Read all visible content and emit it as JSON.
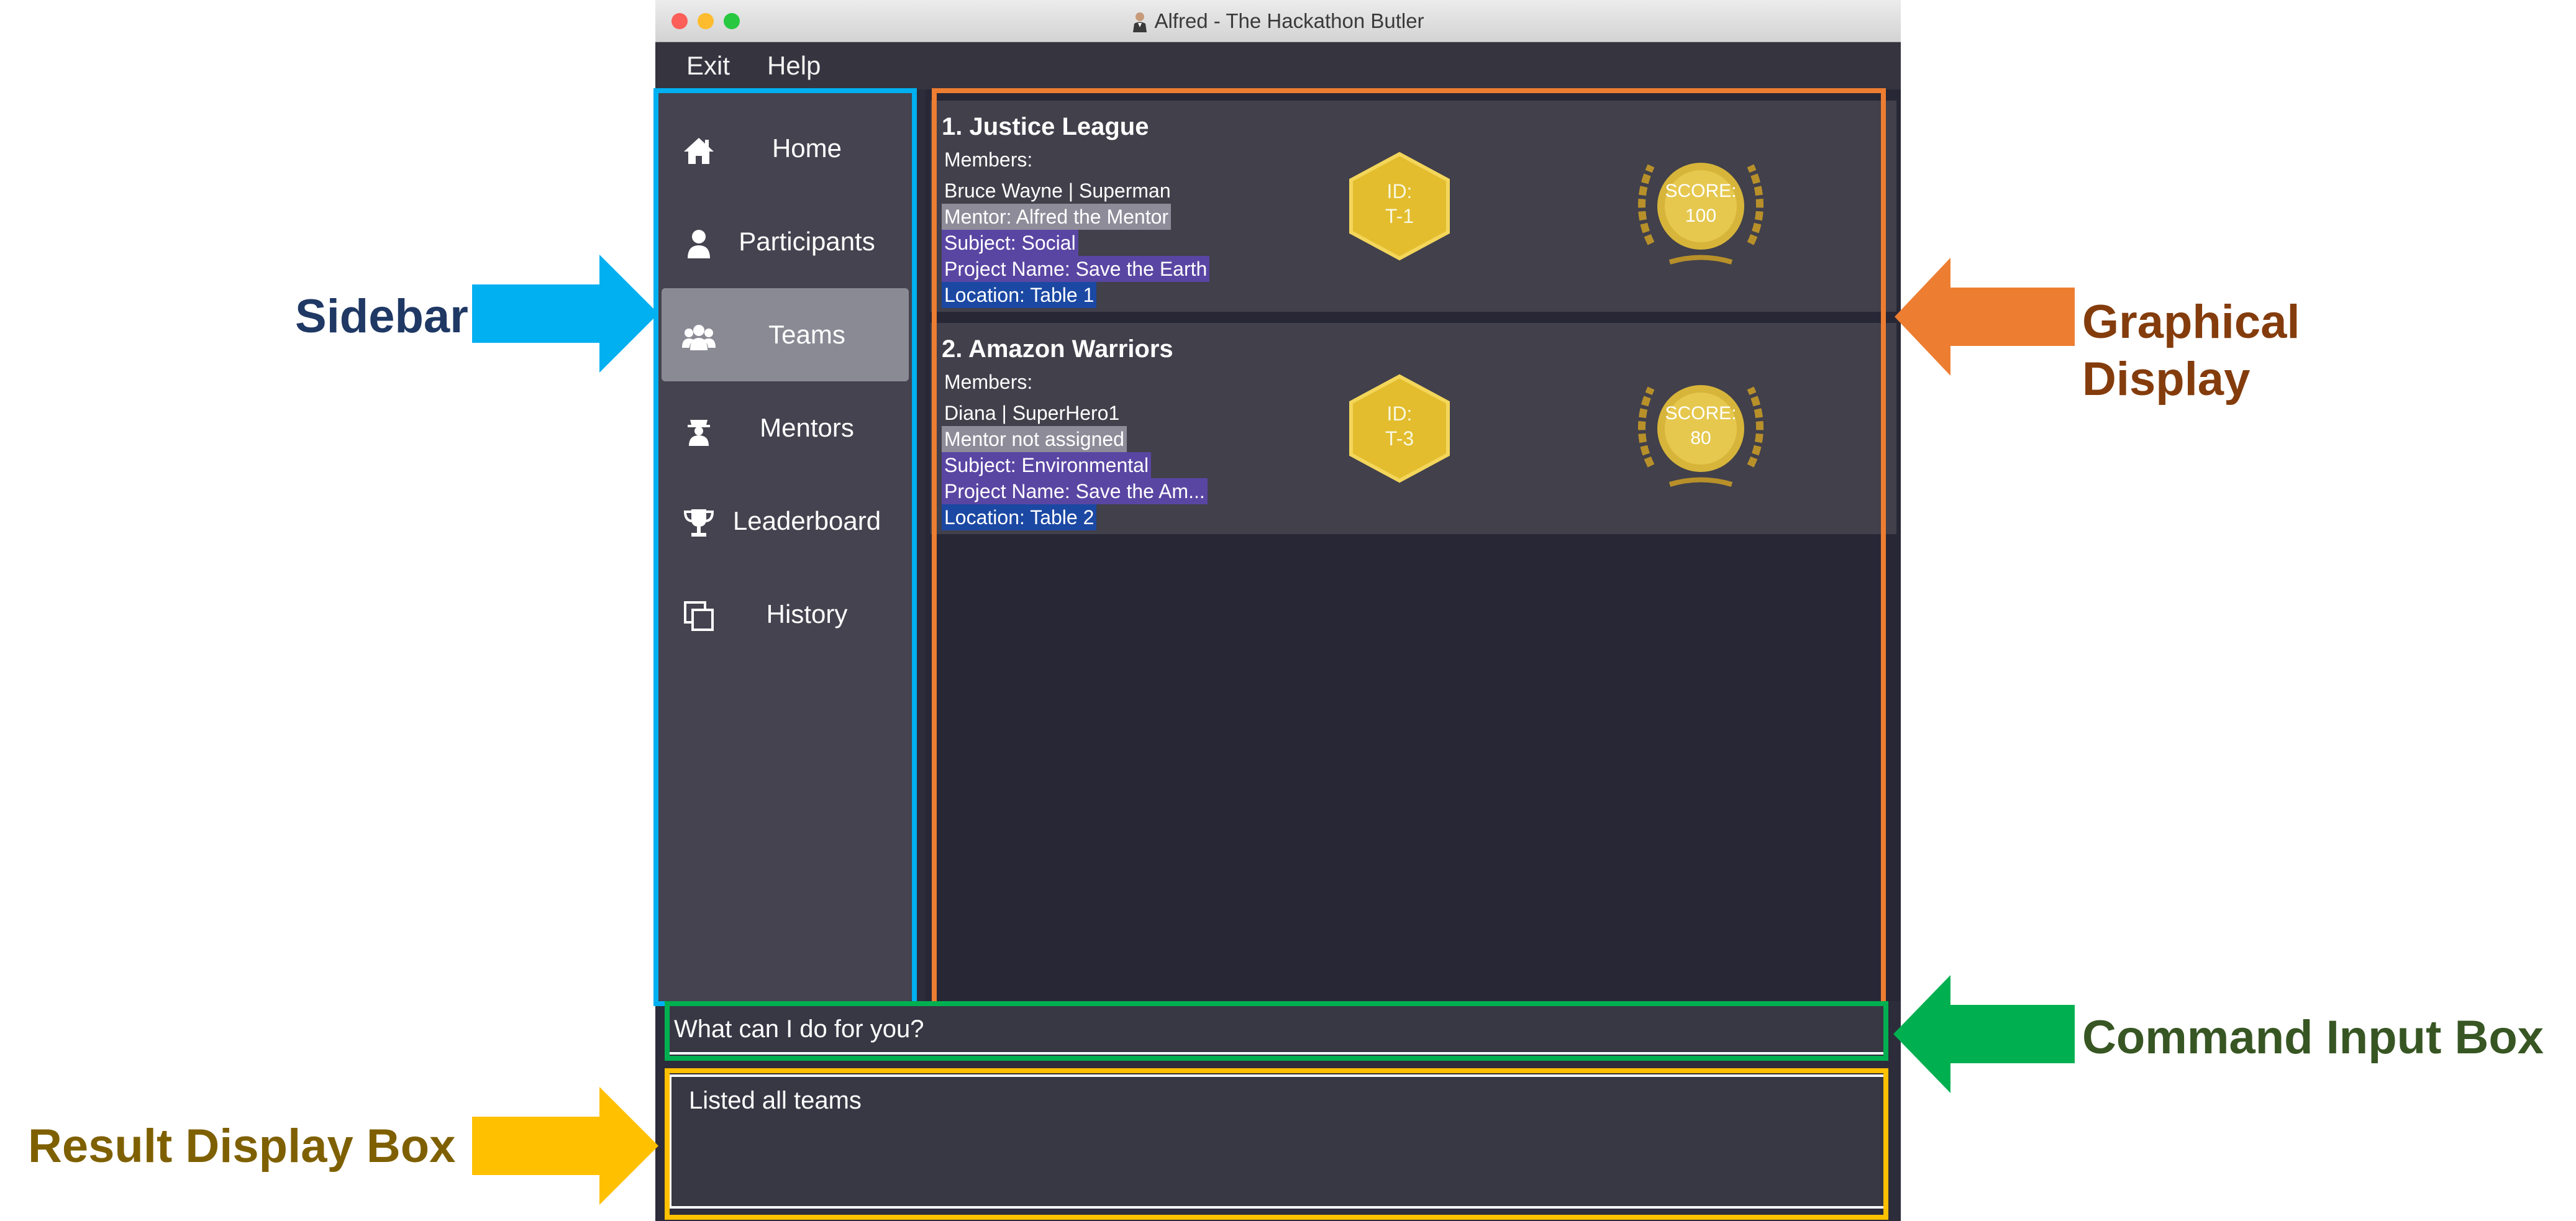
{
  "window": {
    "title": "Alfred - The Hackathon Butler",
    "menu": [
      "Exit",
      "Help"
    ]
  },
  "sidebar": {
    "items": [
      {
        "label": "Home",
        "icon": "home-icon"
      },
      {
        "label": "Participants",
        "icon": "person-icon"
      },
      {
        "label": "Teams",
        "icon": "group-icon",
        "active": true
      },
      {
        "label": "Mentors",
        "icon": "mentor-icon"
      },
      {
        "label": "Leaderboard",
        "icon": "trophy-icon"
      },
      {
        "label": "History",
        "icon": "history-icon"
      }
    ]
  },
  "teams": [
    {
      "heading": "1.  Justice League",
      "members_label": "Members:",
      "members": "Bruce Wayne | Superman",
      "mentor": "Mentor: Alfred the Mentor",
      "subject": "Subject: Social",
      "project": "Project Name: Save the Earth",
      "location": "Location:  Table 1",
      "id_label": "ID:",
      "id": "T-1",
      "score_label": "SCORE:",
      "score": "100"
    },
    {
      "heading": "2.  Amazon Warriors",
      "members_label": "Members:",
      "members": "Diana | SuperHero1",
      "mentor": "Mentor not assigned",
      "subject": "Subject: Environmental",
      "project": "Project Name: Save the Am...",
      "location": "Location:  Table 2",
      "id_label": "ID:",
      "id": "T-3",
      "score_label": "SCORE:",
      "score": "80"
    }
  ],
  "command": {
    "placeholder": "What can I do for you?"
  },
  "result": {
    "text": "Listed all teams"
  },
  "annotations": {
    "sidebar": "Sidebar",
    "graphical_display_line1": "Graphical",
    "graphical_display_line2": "Display",
    "command_input_box": "Command Input Box",
    "result_display_box": "Result Display Box"
  },
  "colors": {
    "sidebar_annotation": "#00b0f0",
    "graphical_annotation": "#ed7d31",
    "command_annotation": "#00b050",
    "result_annotation": "#ffc000",
    "sidebar_label": "#1f3864",
    "graphical_label": "#843c0c",
    "command_label": "#375623",
    "result_label": "#7f6000"
  }
}
